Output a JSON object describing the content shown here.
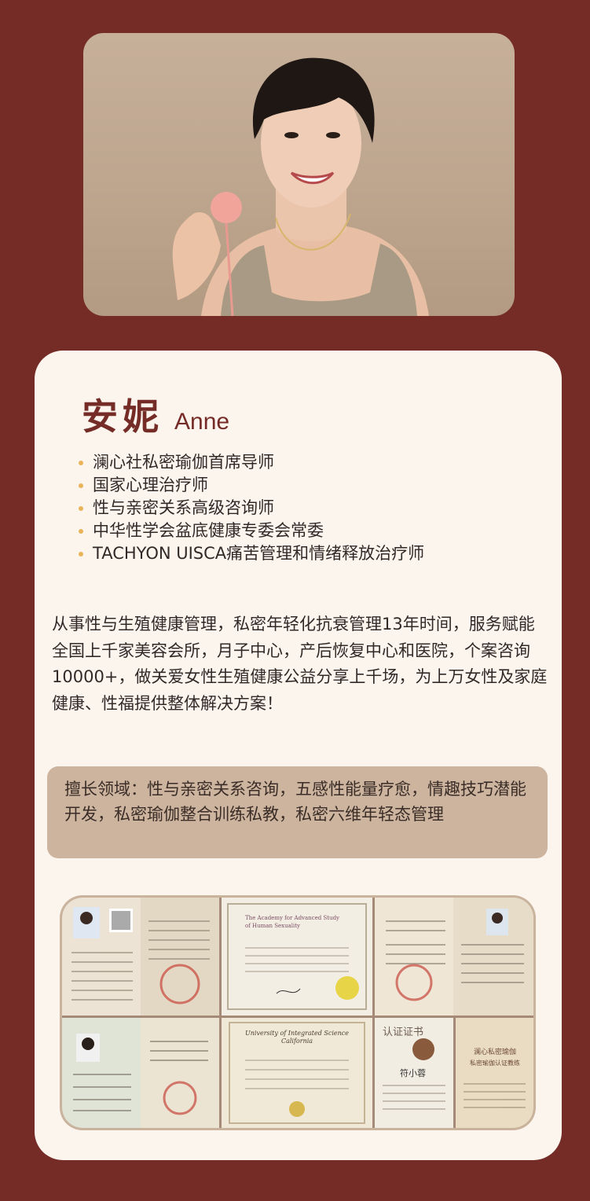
{
  "profile": {
    "name_cn": "安妮",
    "name_en": "Anne"
  },
  "titles": [
    "澜心社私密瑜伽首席导师",
    "国家心理治疗师",
    "性与亲密关系高级咨询师",
    "中华性学会盆底健康专委会常委",
    "TACHYON UISCA痛苦管理和情绪释放治疗师"
  ],
  "intro": "从事性与生殖健康管理，私密年轻化抗衰管理13年时间，服务赋能全国上千家美容会所，月子中心，产后恢复中心和医院，个案咨询10000+，做关爱女性生殖健康公益分享上千场，为上万女性及家庭健康、性福提供整体解决方案！",
  "expertise": "擅长领域：性与亲密关系咨询，五感性能量疗愈，情趣技巧潜能开发，私密瑜伽整合训练私教，私密六维年轻态管理",
  "certificates": {
    "cert_academy_title": "The Academy for Advanced Study of Human Sexuality",
    "cert_university_title": "University of Integrated Science California",
    "cert_recognition_title": "认证证书",
    "cert_recognition_name": "符小蓉",
    "cert_course_title": "澜心私密瑜伽 私密瑜伽认证教练"
  },
  "colors": {
    "background": "#752b26",
    "card": "#fbf5ee",
    "accent": "#752b26",
    "bullet": "#e9b35a",
    "expertise_bg": "#cdb49f"
  }
}
